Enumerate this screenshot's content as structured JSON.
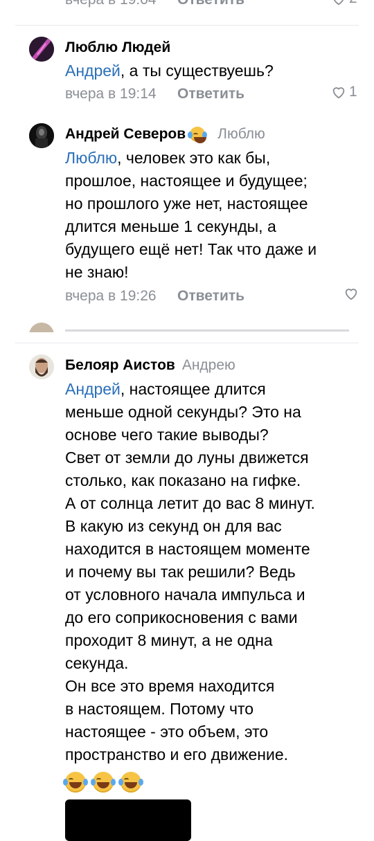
{
  "top_comment": {
    "time": "вчера в 19:04",
    "reply": "Ответить",
    "likes": "2"
  },
  "comments": [
    {
      "author": "Люблю Людей",
      "mention": "Андрей",
      "text": ", а ты существуешь?",
      "time": "вчера в 19:14",
      "reply": "Ответить",
      "likes": "1"
    },
    {
      "author": "Андрей Северов",
      "author_badge": "🙈",
      "to": "Люблю",
      "mention": "Люблю",
      "lines": [
        ", человек это как бы,",
        "прошлое, настоящее и будущее;",
        "но прошлого уже нет, настоящее",
        "длится меньше 1 секунды, а",
        "будущего ещё нет! Так что даже и",
        "не знаю!"
      ],
      "time": "вчера в 19:26",
      "reply": "Ответить"
    },
    {
      "author": "Белояр Аистов",
      "to": "Андрею",
      "mention": "Андрей",
      "lines": [
        ", настоящее длится",
        "меньше одной секунды? Это на",
        "основе чего такие выводы?",
        "Свет от земли до луны движется",
        "столько, как показано на гифке.",
        "А от солнца летит до вас 8 минут.",
        "В какую из секунд он для вас",
        "находится в настоящем моменте",
        "и почему вы так решили? Ведь",
        "от условного начала импульса и",
        "до его соприкосновения с вами",
        "проходит 8 минут, а не одна",
        "секунда.",
        "Он все это время находится",
        "в настоящем. Потому что",
        "настоящее - это объем, это",
        "пространство и его движение."
      ]
    }
  ],
  "colors": {
    "mention": "#2a6fb8",
    "meta": "#8a8f96"
  }
}
